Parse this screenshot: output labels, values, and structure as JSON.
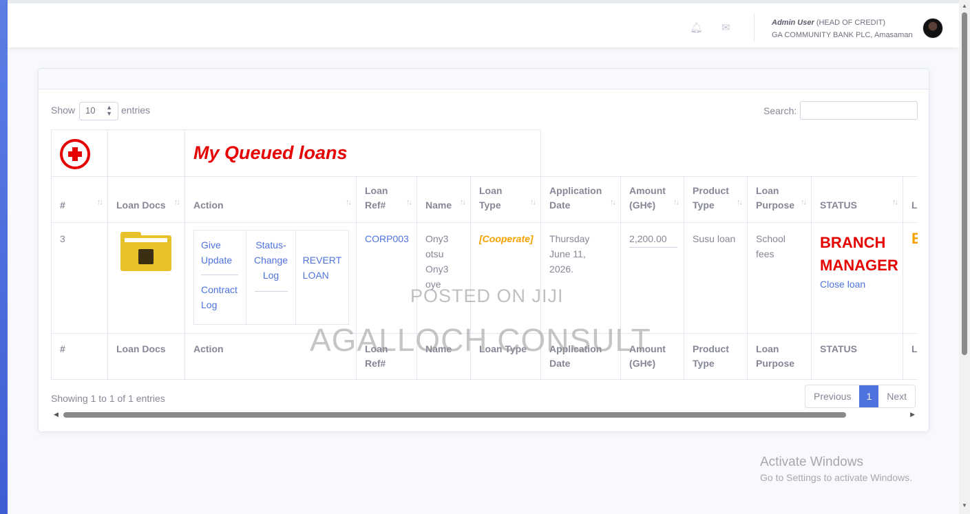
{
  "header": {
    "user_name": "Admin User",
    "user_role": "(HEAD OF CREDIT)",
    "bank": "GA COMMUNITY BANK PLC, Amasaman",
    "icons": [
      "bell-icon",
      "envelope-icon"
    ]
  },
  "controls": {
    "show_label": "Show",
    "page_size": "10",
    "entries_label": "entries",
    "search_label": "Search:"
  },
  "table": {
    "title": "My Queued loans",
    "columns": [
      "#",
      "Loan Docs",
      "Action",
      "Loan Ref#",
      "Name",
      "Loan Type",
      "Application Date",
      "Amount (GH¢)",
      "Product Type",
      "Loan Purpose",
      "STATUS",
      "LI"
    ],
    "footer_columns": [
      "#",
      "Loan Docs",
      "Action",
      "Loan Ref#",
      "Name",
      "Loan Type",
      "Application Date",
      "Amount (GH¢)",
      "Product Type",
      "Loan Purpose",
      "STATUS",
      "LI"
    ],
    "row": {
      "num": "3",
      "actions": {
        "give_update": "Give Update",
        "contract_log": "Contract Log",
        "status_change_log": "Status-Change Log",
        "revert_loan": "REVERT LOAN"
      },
      "loan_ref": "CORP003",
      "name": "Ony3 otsu Ony3 oye",
      "loan_type": "[Cooperate]",
      "application_date": "Thursday June 11, 2026.",
      "amount": "2,200.00",
      "product_type": "Susu loan",
      "loan_purpose": "School fees",
      "status": "BRANCH MANAGER",
      "close_loan": "Close loan",
      "last_col": "E"
    }
  },
  "footer": {
    "showing": "Showing 1 to 1 of 1 entries",
    "previous": "Previous",
    "page": "1",
    "next": "Next"
  },
  "watermarks": {
    "posted": "POSTED ON JIJI",
    "consult": "AGALLOCH CONSULT"
  },
  "windows": {
    "activate": "Activate Windows",
    "goto": "Go to Settings to activate Windows."
  },
  "colors": {
    "accent": "#4e73df",
    "red": "#e60000",
    "orange": "#f6a100"
  }
}
